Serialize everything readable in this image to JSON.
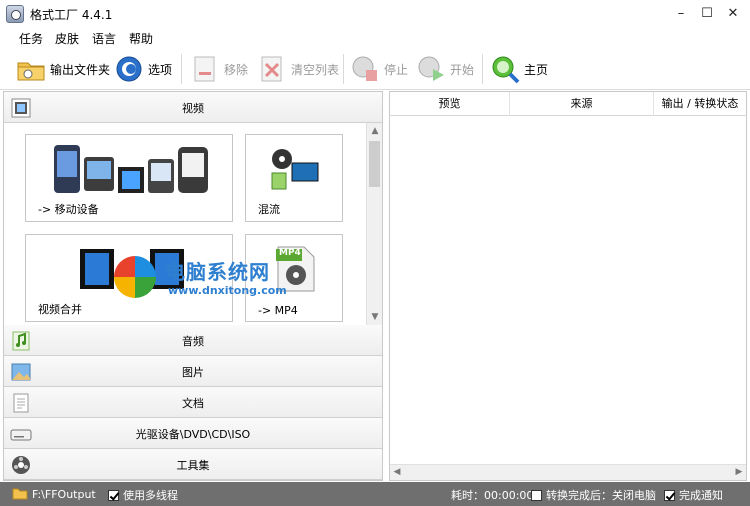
{
  "window": {
    "title": "格式工厂 4.4.1",
    "minimize": "–",
    "maximize": "☐",
    "close": "✕"
  },
  "menu": [
    "任务",
    "皮肤",
    "语言",
    "帮助"
  ],
  "toolbar": {
    "output_folder": "输出文件夹",
    "options": "选项",
    "remove": "移除",
    "clear_list": "清空列表",
    "stop": "停止",
    "start": "开始",
    "home": "主页"
  },
  "categories": {
    "video": "视频",
    "audio": "音频",
    "picture": "图片",
    "document": "文档",
    "optical": "光驱设备\\DVD\\CD\\ISO",
    "tools": "工具集"
  },
  "video_tiles": {
    "mobile": "-> 移动设备",
    "mix": "混流",
    "merge": "视频合并",
    "mp4": "-> MP4",
    "mp4_badge": "MP4"
  },
  "table": {
    "columns": [
      "预览",
      "来源",
      "输出 / 转换状态"
    ]
  },
  "status": {
    "output_path": "F:\\FFOutput",
    "multithread": "使用多线程",
    "elapsed": "耗时：00:00:00",
    "after_convert": "转换完成后：关闭电脑",
    "notify": "完成通知"
  },
  "watermark": {
    "title": "电脑系统网",
    "url": "www.dnxitong.com"
  }
}
